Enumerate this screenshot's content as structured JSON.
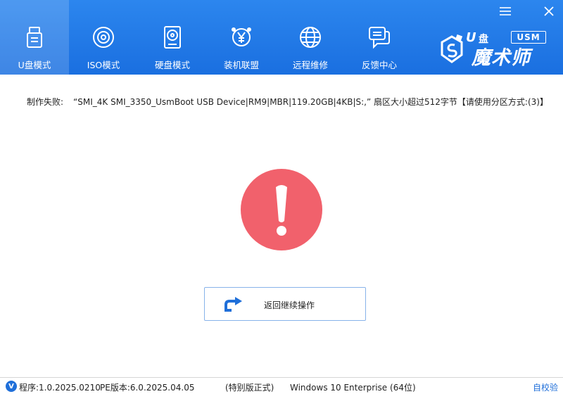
{
  "window": {
    "controls": [
      "menu-icon",
      "close-icon"
    ]
  },
  "tabs": [
    {
      "label": "U盘模式",
      "icon": "usb-drive-icon",
      "active": true
    },
    {
      "label": "ISO模式",
      "icon": "disc-icon",
      "active": false
    },
    {
      "label": "硬盘模式",
      "icon": "hard-disk-icon",
      "active": false
    },
    {
      "label": "装机联盟",
      "icon": "yuan-icon",
      "active": false
    },
    {
      "label": "远程维修",
      "icon": "globe-icon",
      "active": false
    },
    {
      "label": "反馈中心",
      "icon": "chat-icon",
      "active": false
    }
  ],
  "logo": {
    "usm": "USM",
    "u_mark": "U",
    "u_sub": "盘",
    "brand": "魔术师"
  },
  "message": {
    "prefix": "制作失败:",
    "text": "“SMI_4K SMI_3350_UsmBoot USB Device|RM9|MBR|119.20GB|4KB|S:,” 扇区大小超过512字节【请使用分区方式:(3)】"
  },
  "error": {
    "icon": "exclamation-icon",
    "color": "#f1616c"
  },
  "return_button": {
    "label": "返回继续操作",
    "icon": "return-arrow-icon"
  },
  "statusbar": {
    "program_version": "程序:1.0.2025.0210",
    "pe_version": "PE版本:6.0.2025.04.05",
    "edition": "(特别版正式)",
    "os": "Windows 10 Enterprise (64位)",
    "self_check": "自校验",
    "icon_letter": "V"
  },
  "colors": {
    "header": "#1a6fe0",
    "accent": "#1f6fd9",
    "error": "#f1616c"
  }
}
